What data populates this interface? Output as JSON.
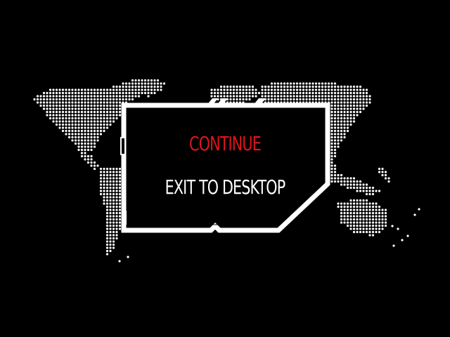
{
  "menu": {
    "items": [
      {
        "label": "CONTINUE",
        "state": "selected"
      },
      {
        "label": "EXIT TO DESKTOP",
        "state": "normal"
      }
    ]
  },
  "colors": {
    "background": "#000000",
    "selected_text": "#e0141b",
    "normal_text": "#ffffff",
    "frame": "#ffffff",
    "map_dots": "#ffffff"
  },
  "decor": {
    "background": "dotted-world-map"
  }
}
